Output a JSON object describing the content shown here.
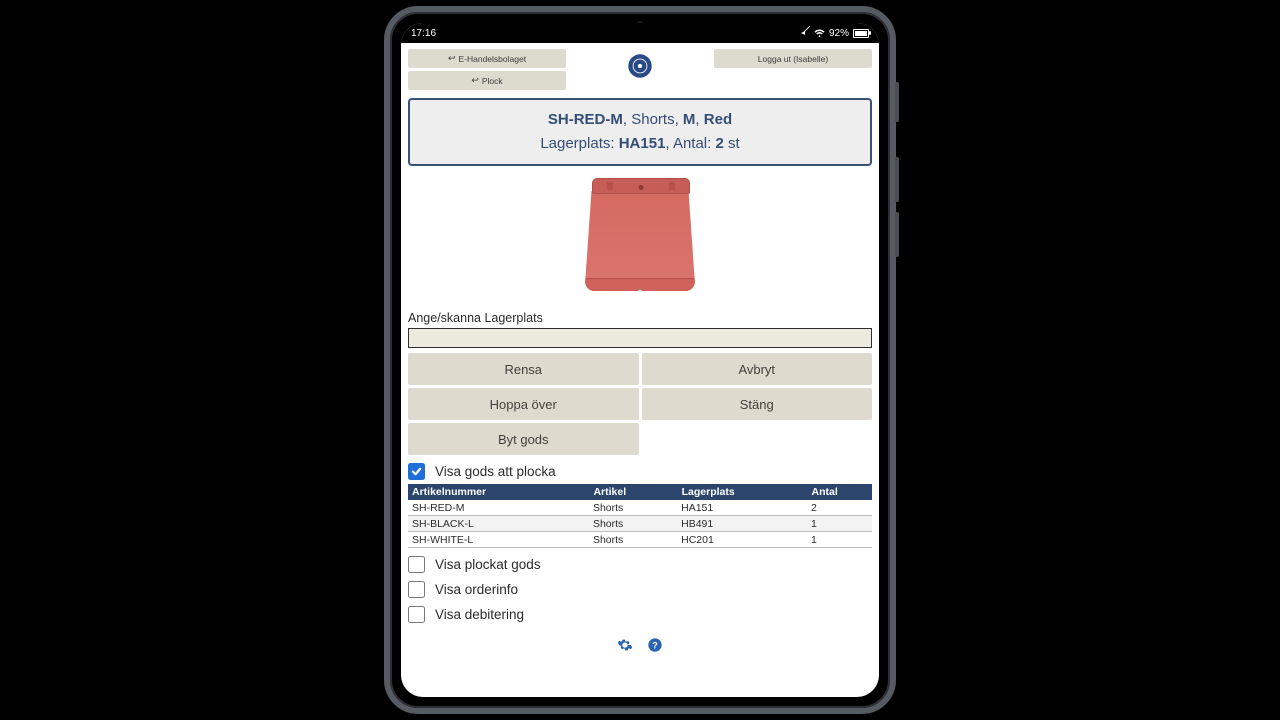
{
  "status": {
    "time": "17:16",
    "battery": "92%"
  },
  "topbar": {
    "left": [
      "E-Handelsbolaget",
      "Plock"
    ],
    "logout": "Logga ut (Isabelle)"
  },
  "summary": {
    "sku": "SH-RED-M",
    "article": "Shorts",
    "size": "M",
    "color": "Red",
    "loc_label": "Lagerplats",
    "location": "HA151",
    "qty_label": "Antal",
    "qty": "2",
    "unit": "st"
  },
  "scan_label": "Ange/skanna Lagerplats",
  "scan_value": "",
  "buttons": {
    "clear": "Rensa",
    "cancel": "Avbryt",
    "skip": "Hoppa över",
    "close": "Stäng",
    "swap": "Byt gods"
  },
  "checks": {
    "to_pick": "Visa gods att plocka",
    "picked": "Visa plockat gods",
    "orderinfo": "Visa orderinfo",
    "billing": "Visa debitering"
  },
  "table": {
    "headers": [
      "Artikelnummer",
      "Artikel",
      "Lagerplats",
      "Antal"
    ],
    "rows": [
      [
        "SH-RED-M",
        "Shorts",
        "HA151",
        "2"
      ],
      [
        "SH-BLACK-L",
        "Shorts",
        "HB491",
        "1"
      ],
      [
        "SH-WHITE-L",
        "Shorts",
        "HC201",
        "1"
      ]
    ]
  }
}
